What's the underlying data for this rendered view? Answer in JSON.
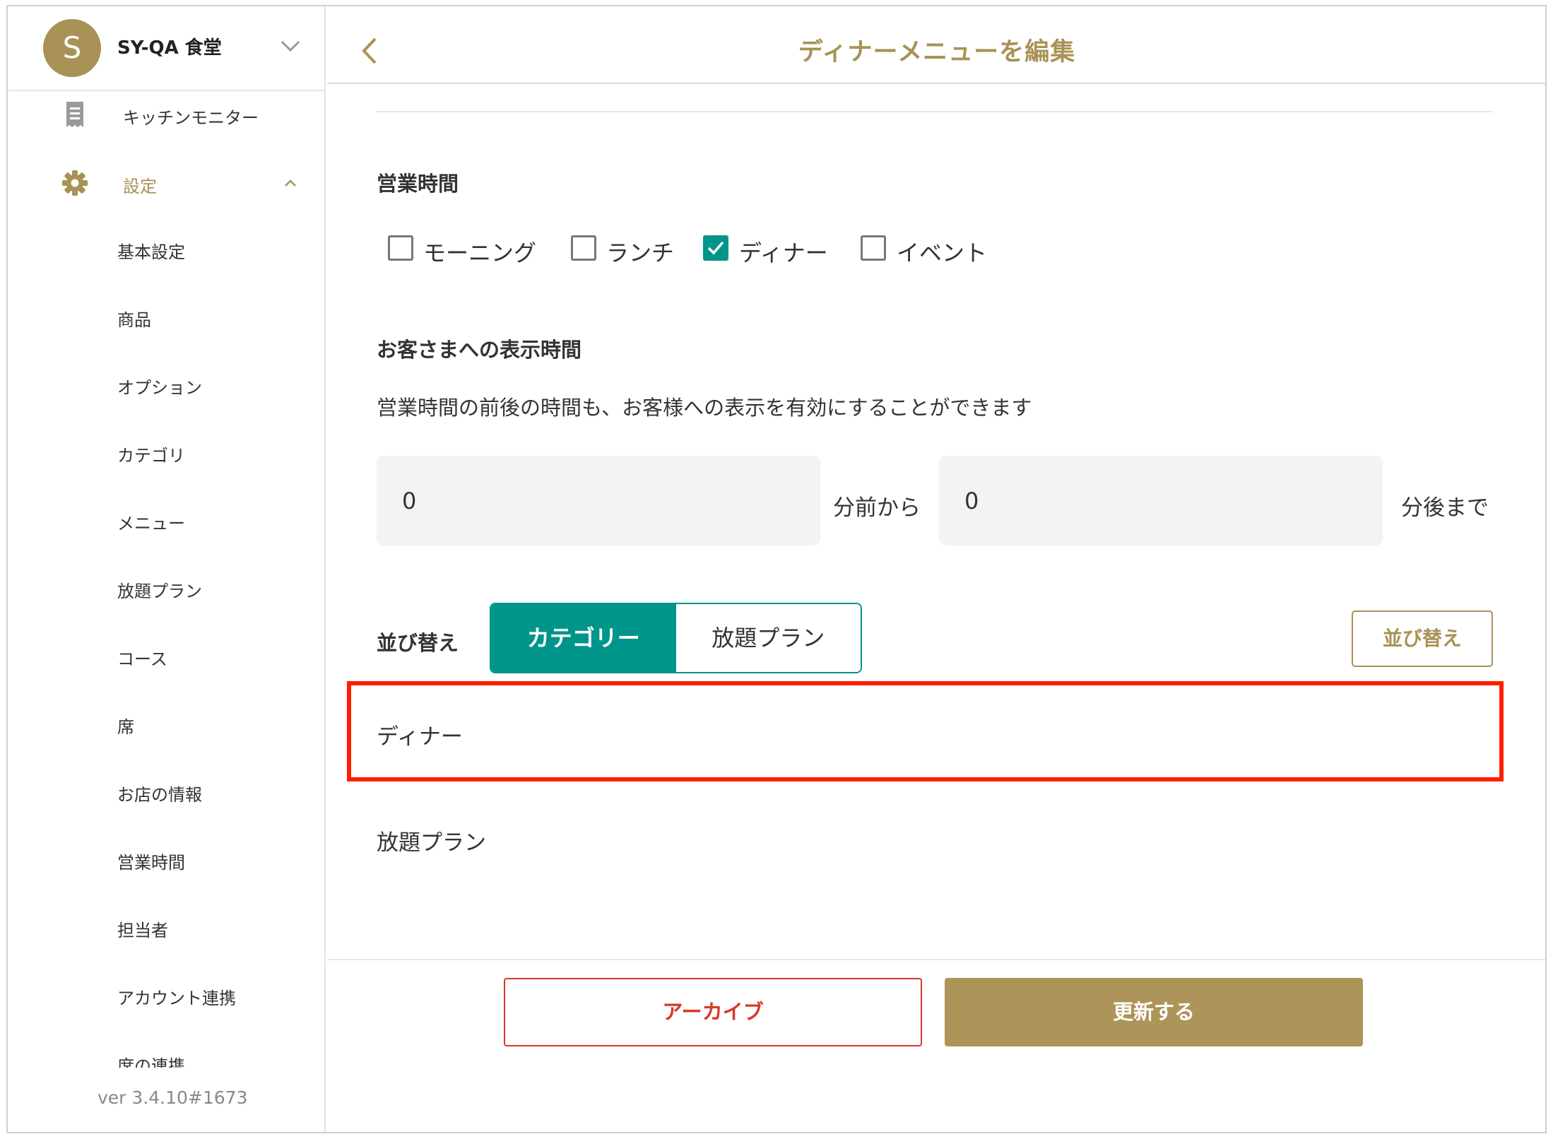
{
  "colors": {
    "accent_gold": "#a89255",
    "teal": "#00958a",
    "danger": "#d9372a",
    "highlight_red": "#ff1f00"
  },
  "sidebar": {
    "store": {
      "avatar_letter": "S",
      "name": "SY-QA 食堂"
    },
    "kitchen_monitor": {
      "label": "キッチンモニター",
      "icon": "receipt-icon"
    },
    "settings": {
      "label": "設定",
      "icon": "gear-icon",
      "expanded": true
    },
    "sub_items": [
      "基本設定",
      "商品",
      "オプション",
      "カテゴリ",
      "メニュー",
      "放題プラン",
      "コース",
      "席",
      "お店の情報",
      "営業時間",
      "担当者",
      "アカウント連携",
      "席の連携"
    ],
    "version": "ver 3.4.10#1673"
  },
  "header": {
    "title": "ディナーメニューを編集",
    "back_icon": "chevron-left-icon"
  },
  "business_hours": {
    "title": "営業時間",
    "options": [
      {
        "label": "モーニング",
        "checked": false
      },
      {
        "label": "ランチ",
        "checked": false
      },
      {
        "label": "ディナー",
        "checked": true
      },
      {
        "label": "イベント",
        "checked": false
      }
    ]
  },
  "display_time": {
    "title": "お客さまへの表示時間",
    "description": "営業時間の前後の時間も、お客様への表示を有効にすることができます",
    "before_value": "0",
    "before_unit": "分前から",
    "after_value": "0",
    "after_unit": "分後まで"
  },
  "sorting": {
    "label": "並び替え",
    "tabs": [
      {
        "label": "カテゴリー",
        "active": true
      },
      {
        "label": "放題プラン",
        "active": false
      }
    ],
    "sort_button": "並び替え"
  },
  "list": [
    "ディナー",
    "放題プラン"
  ],
  "footer": {
    "archive_label": "アーカイブ",
    "update_label": "更新する"
  }
}
